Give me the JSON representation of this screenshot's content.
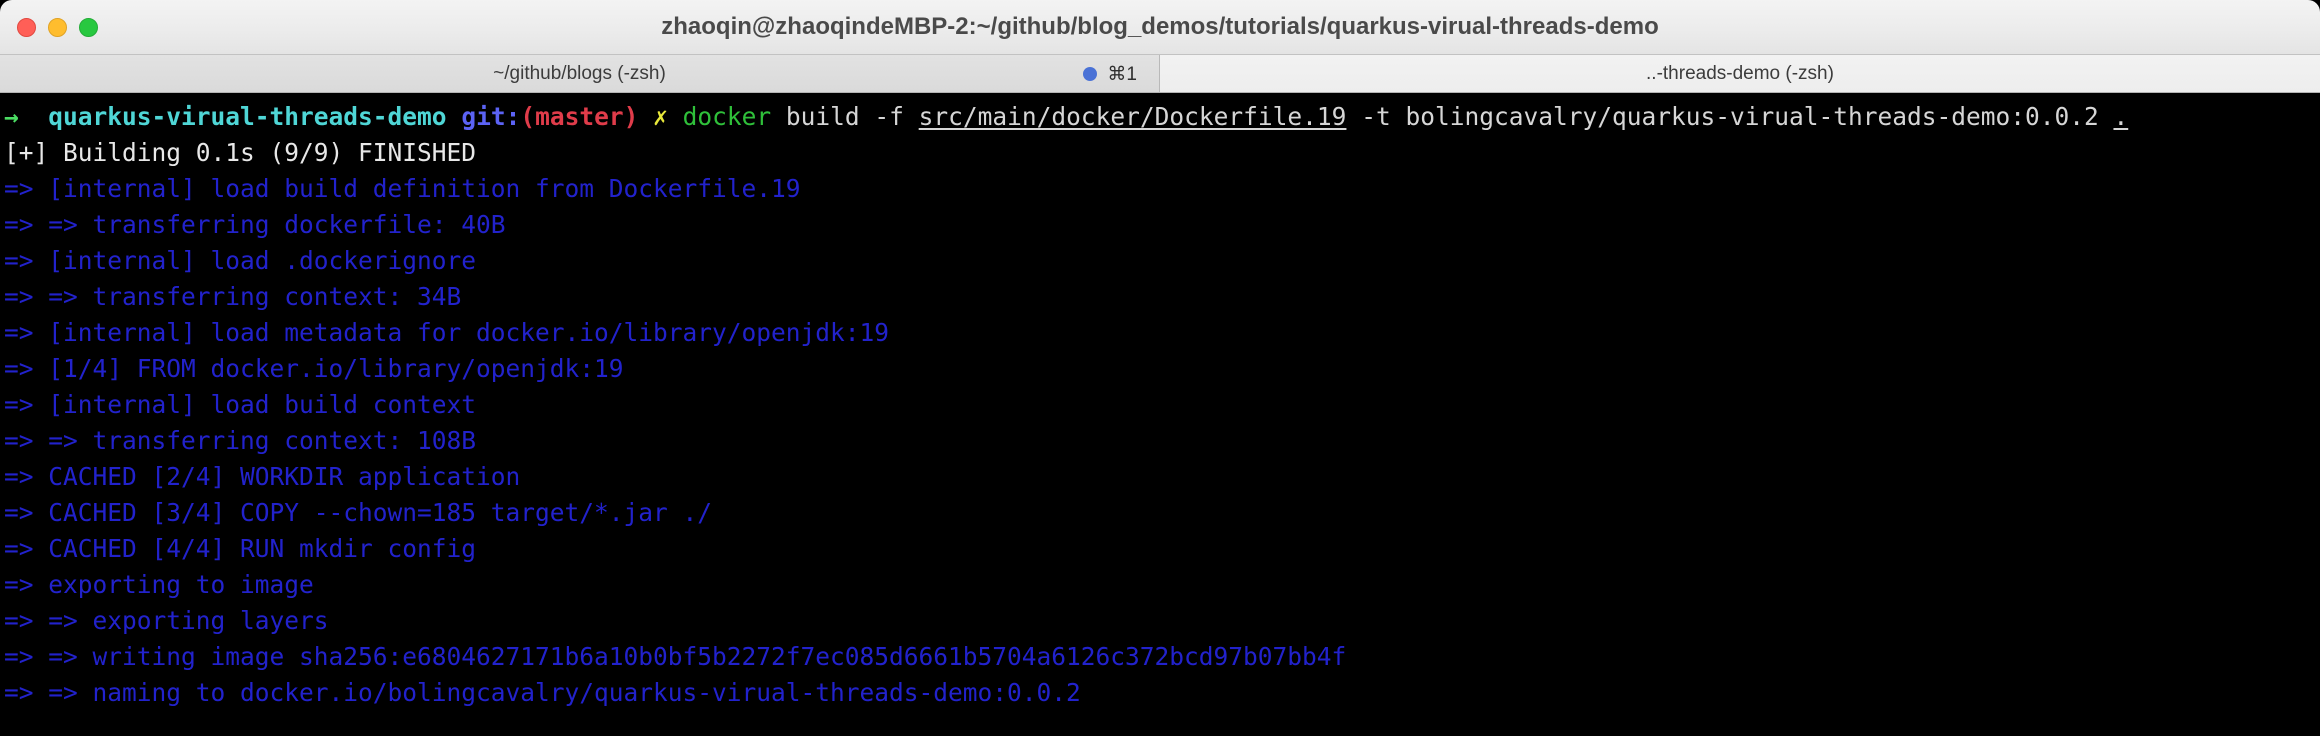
{
  "window": {
    "title": "zhaoqin@zhaoqindeMBP-2:~/github/blog_demos/tutorials/quarkus-virual-threads-demo",
    "controls": {
      "close_label": "",
      "minimize_label": "",
      "maximize_label": ""
    },
    "colors": {
      "close": "#ff5f57",
      "minimize": "#ffbd2e",
      "maximize": "#28c840",
      "activity_dot": "#4a72d6",
      "background": "#000000",
      "titlebar": "#ececec",
      "tabbar": "#d9d9d9"
    }
  },
  "tabs": [
    {
      "label": "~/github/blogs (-zsh)",
      "active": false,
      "shortcut": "⌘1",
      "has_activity_dot": true
    },
    {
      "label": "..-threads-demo (-zsh)",
      "active": true,
      "shortcut": "",
      "has_activity_dot": false
    }
  ],
  "prompt": {
    "arrow": "→",
    "directory": "quarkus-virual-threads-demo",
    "git_label": "git:",
    "branch": "(master)",
    "dirty_marker": "✗",
    "command_name": "docker",
    "command_args_pre": " build -f ",
    "dockerfile_path": "src/main/docker/Dockerfile.19",
    "command_args_mid": " -t bolingcavalry/quarkus-virual-threads-demo:0.0.2 ",
    "build_context": "."
  },
  "build": {
    "summary": "[+] Building 0.1s (9/9) FINISHED",
    "steps": [
      "=> [internal] load build definition from Dockerfile.19",
      "=> => transferring dockerfile: 40B",
      "=> [internal] load .dockerignore",
      "=> => transferring context: 34B",
      "=> [internal] load metadata for docker.io/library/openjdk:19",
      "=> [1/4] FROM docker.io/library/openjdk:19",
      "=> [internal] load build context",
      "=> => transferring context: 108B",
      "=> CACHED [2/4] WORKDIR application",
      "=> CACHED [3/4] COPY --chown=185 target/*.jar ./",
      "=> CACHED [4/4] RUN mkdir config",
      "=> exporting to image",
      "=> => exporting layers",
      "=> => writing image sha256:e6804627171b6a10b0bf5b2272f7ec085d6661b5704a6126c372bcd97b07bb4f",
      "=> => naming to docker.io/bolingcavalry/quarkus-virual-threads-demo:0.0.2"
    ]
  }
}
